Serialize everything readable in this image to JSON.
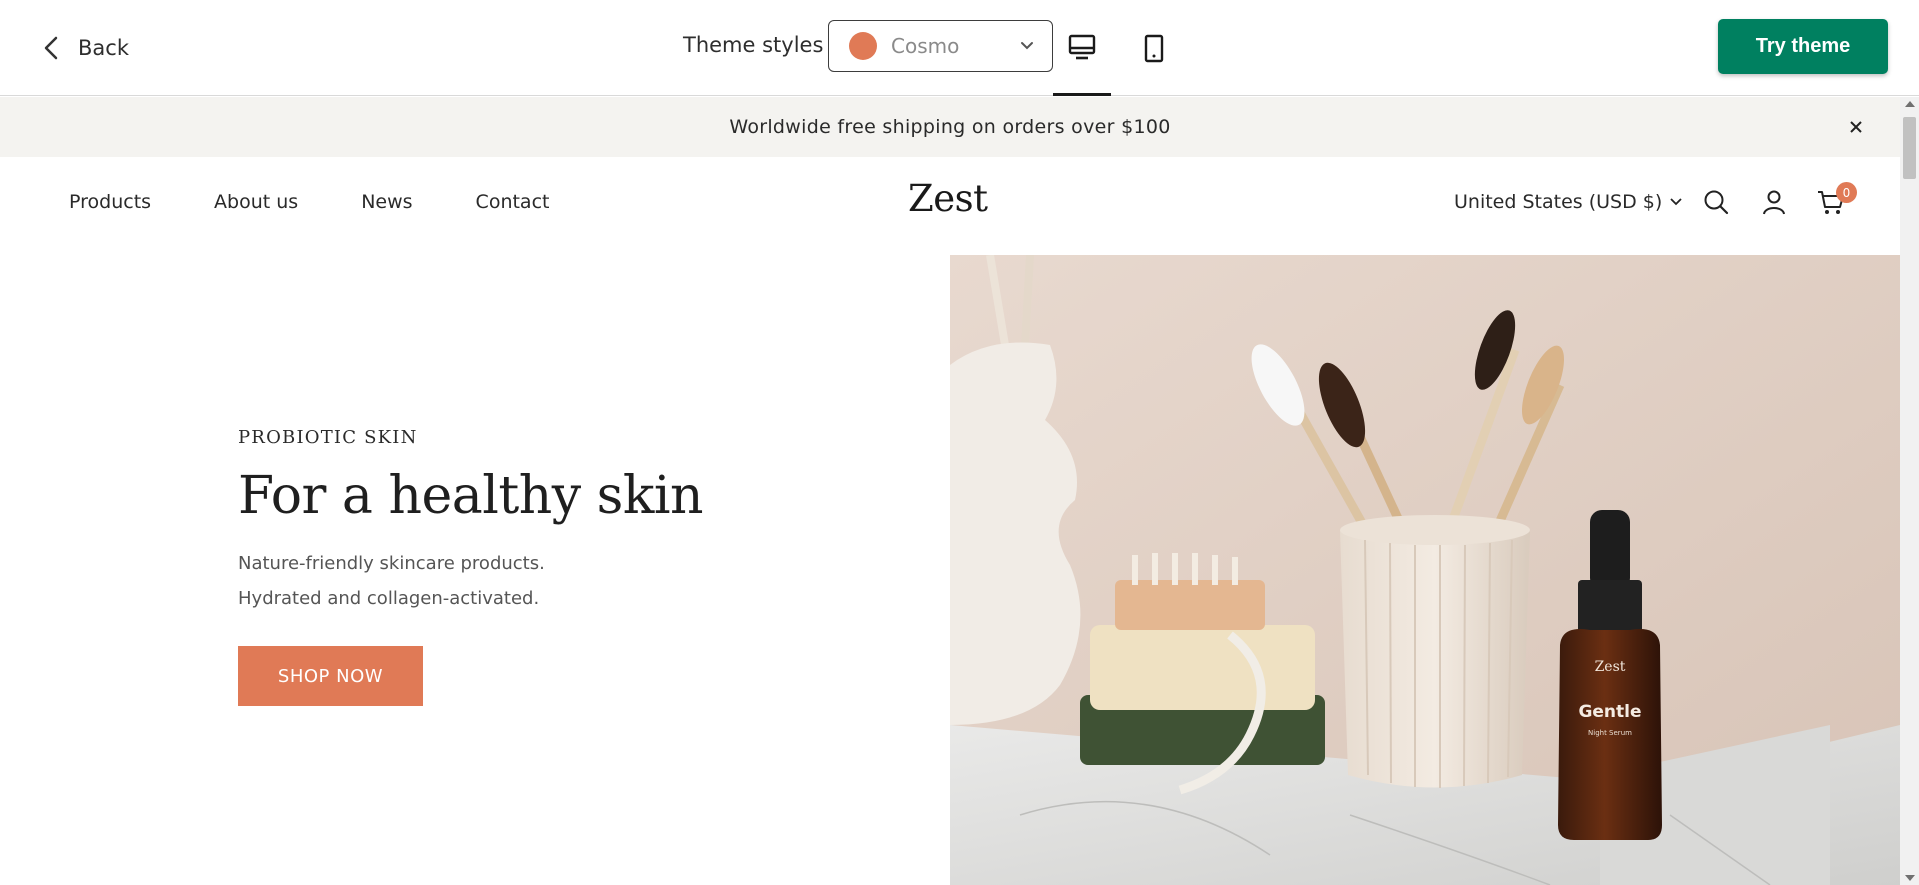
{
  "toolbar": {
    "back_label": "Back",
    "theme_styles_label": "Theme styles",
    "theme_select": {
      "value": "Cosmo",
      "swatch_color": "#e07a56"
    },
    "try_theme_label": "Try theme",
    "active_device": "desktop",
    "accent_color": "#008060"
  },
  "announcement": {
    "text": "Worldwide free shipping on orders over $100"
  },
  "header": {
    "nav": [
      "Products",
      "About us",
      "News",
      "Contact"
    ],
    "logo": "Zest",
    "currency": "United States (USD $)",
    "cart_count": "0"
  },
  "hero": {
    "eyebrow": "PROBIOTIC SKIN",
    "headline": "For a healthy skin",
    "sub_line_1": "Nature-friendly skincare products.",
    "sub_line_2": "Hydrated and collagen-activated.",
    "cta": "SHOP NOW",
    "cta_color": "#e07a56",
    "bottle_brand": "Zest",
    "bottle_name": "Gentle",
    "bottle_sub": "Night Serum"
  }
}
